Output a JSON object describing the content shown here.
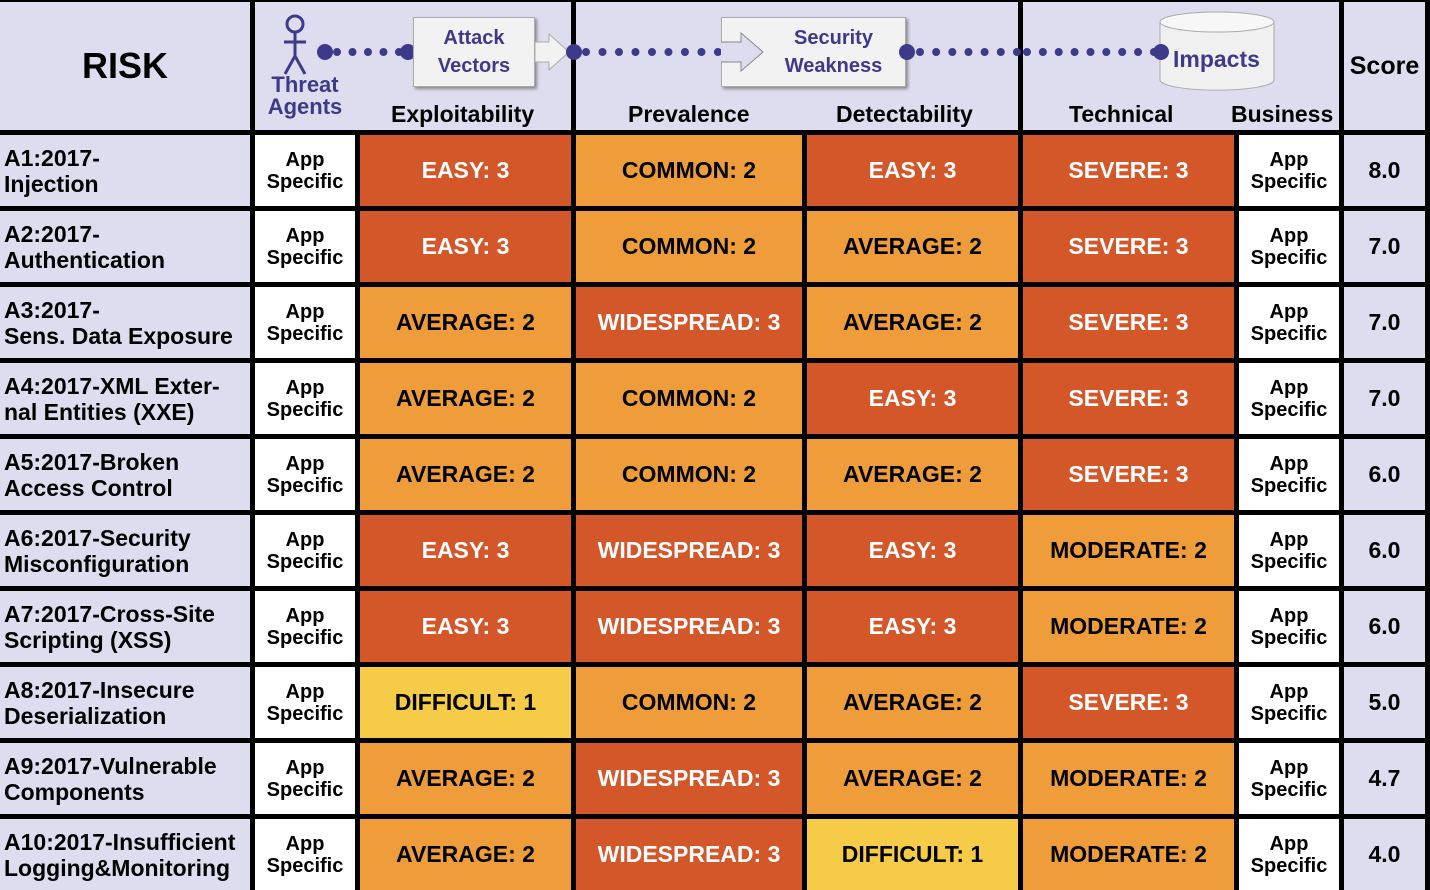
{
  "header": {
    "risk": "RISK",
    "threat_agents": "Threat Agents",
    "attack_vectors": "Attack Vectors",
    "exploitability": "Exploitability",
    "security_weakness": "Security Weakness",
    "prevalence": "Prevalence",
    "detectability": "Detectability",
    "impacts": "Impacts",
    "technical": "Technical",
    "business": "Business",
    "score": "Score"
  },
  "colors": {
    "high": "#D4572A",
    "medium": "#EF9D3A",
    "low": "#F5CB47",
    "header_bg": "#DEDDEF",
    "accent": "#3D3A8A"
  },
  "app_specific": "App Specific",
  "rows": [
    {
      "risk": "A1:2017-\nInjection",
      "exploitability": {
        "label": "EASY: 3",
        "level": 3
      },
      "prevalence": {
        "label": "COMMON: 2",
        "level": 2
      },
      "detectability": {
        "label": "EASY: 3",
        "level": 3
      },
      "technical": {
        "label": "SEVERE: 3",
        "level": 3
      },
      "score": "8.0"
    },
    {
      "risk": "A2:2017-\nAuthentication",
      "exploitability": {
        "label": "EASY: 3",
        "level": 3
      },
      "prevalence": {
        "label": "COMMON: 2",
        "level": 2
      },
      "detectability": {
        "label": "AVERAGE: 2",
        "level": 2
      },
      "technical": {
        "label": "SEVERE: 3",
        "level": 3
      },
      "score": "7.0"
    },
    {
      "risk": "A3:2017-\nSens. Data Exposure",
      "exploitability": {
        "label": "AVERAGE: 2",
        "level": 2
      },
      "prevalence": {
        "label": "WIDESPREAD: 3",
        "level": 3
      },
      "detectability": {
        "label": "AVERAGE: 2",
        "level": 2
      },
      "technical": {
        "label": "SEVERE: 3",
        "level": 3
      },
      "score": "7.0"
    },
    {
      "risk": "A4:2017-XML Exter-\nnal Entities (XXE)",
      "exploitability": {
        "label": "AVERAGE: 2",
        "level": 2
      },
      "prevalence": {
        "label": "COMMON: 2",
        "level": 2
      },
      "detectability": {
        "label": "EASY: 3",
        "level": 3
      },
      "technical": {
        "label": "SEVERE: 3",
        "level": 3
      },
      "score": "7.0"
    },
    {
      "risk": "A5:2017-Broken\nAccess Control",
      "exploitability": {
        "label": "AVERAGE: 2",
        "level": 2
      },
      "prevalence": {
        "label": "COMMON: 2",
        "level": 2
      },
      "detectability": {
        "label": "AVERAGE: 2",
        "level": 2
      },
      "technical": {
        "label": "SEVERE: 3",
        "level": 3
      },
      "score": "6.0"
    },
    {
      "risk": "A6:2017-Security\nMisconfiguration",
      "exploitability": {
        "label": "EASY: 3",
        "level": 3
      },
      "prevalence": {
        "label": "WIDESPREAD: 3",
        "level": 3
      },
      "detectability": {
        "label": "EASY: 3",
        "level": 3
      },
      "technical": {
        "label": "MODERATE: 2",
        "level": 2
      },
      "score": "6.0"
    },
    {
      "risk": "A7:2017-Cross-Site\nScripting (XSS)",
      "exploitability": {
        "label": "EASY: 3",
        "level": 3
      },
      "prevalence": {
        "label": "WIDESPREAD: 3",
        "level": 3
      },
      "detectability": {
        "label": "EASY: 3",
        "level": 3
      },
      "technical": {
        "label": "MODERATE: 2",
        "level": 2
      },
      "score": "6.0"
    },
    {
      "risk": "A8:2017-Insecure\nDeserialization",
      "exploitability": {
        "label": "DIFFICULT: 1",
        "level": 1
      },
      "prevalence": {
        "label": "COMMON: 2",
        "level": 2
      },
      "detectability": {
        "label": "AVERAGE: 2",
        "level": 2
      },
      "technical": {
        "label": "SEVERE: 3",
        "level": 3
      },
      "score": "5.0"
    },
    {
      "risk": "A9:2017-Vulnerable\nComponents",
      "exploitability": {
        "label": "AVERAGE: 2",
        "level": 2
      },
      "prevalence": {
        "label": "WIDESPREAD: 3",
        "level": 3
      },
      "detectability": {
        "label": "AVERAGE: 2",
        "level": 2
      },
      "technical": {
        "label": "MODERATE: 2",
        "level": 2
      },
      "score": "4.7"
    },
    {
      "risk": "A10:2017-Insufficient\nLogging&Monitoring",
      "exploitability": {
        "label": "AVERAGE: 2",
        "level": 2
      },
      "prevalence": {
        "label": "WIDESPREAD: 3",
        "level": 3
      },
      "detectability": {
        "label": "DIFFICULT: 1",
        "level": 1
      },
      "technical": {
        "label": "MODERATE: 2",
        "level": 2
      },
      "score": "4.0"
    }
  ]
}
